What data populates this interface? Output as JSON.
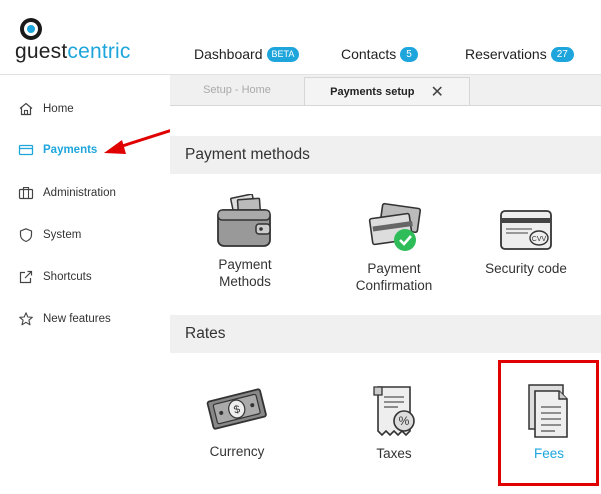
{
  "brand": {
    "part1": "guest",
    "part2": "centric"
  },
  "topnav": [
    {
      "label": "Dashboard",
      "badge": "BETA"
    },
    {
      "label": "Contacts",
      "badge": "5"
    },
    {
      "label": "Reservations",
      "badge": "27"
    }
  ],
  "sidebar": {
    "items": [
      {
        "label": "Home",
        "icon": "home-icon"
      },
      {
        "label": "Payments",
        "icon": "card-icon",
        "active": true
      },
      {
        "label": "Administration",
        "icon": "briefcase-icon"
      },
      {
        "label": "System",
        "icon": "shield-icon"
      },
      {
        "label": "Shortcuts",
        "icon": "external-link-icon"
      },
      {
        "label": "New features",
        "icon": "star-icon"
      }
    ]
  },
  "tabs": [
    {
      "label": "Setup - Home"
    },
    {
      "label": "Payments setup",
      "close": "✕"
    }
  ],
  "sections": [
    {
      "title": "Payment methods",
      "cards": [
        {
          "line1": "Payment",
          "line2": "Methods",
          "icon": "wallet-icon"
        },
        {
          "line1": "Payment",
          "line2": "Confirmation",
          "icon": "card-check-icon"
        },
        {
          "line1": "Security code",
          "line2": "",
          "icon": "cvv-card-icon"
        }
      ]
    },
    {
      "title": "Rates",
      "cards": [
        {
          "line1": "Currency",
          "line2": "",
          "icon": "banknote-icon"
        },
        {
          "line1": "Taxes",
          "line2": "",
          "icon": "tax-receipt-icon"
        },
        {
          "line1": "Fees",
          "line2": "",
          "icon": "document-icon"
        }
      ]
    }
  ],
  "colors": {
    "accent": "#1ea6dc",
    "annotation": "#e00000",
    "check": "#2ebd59"
  }
}
